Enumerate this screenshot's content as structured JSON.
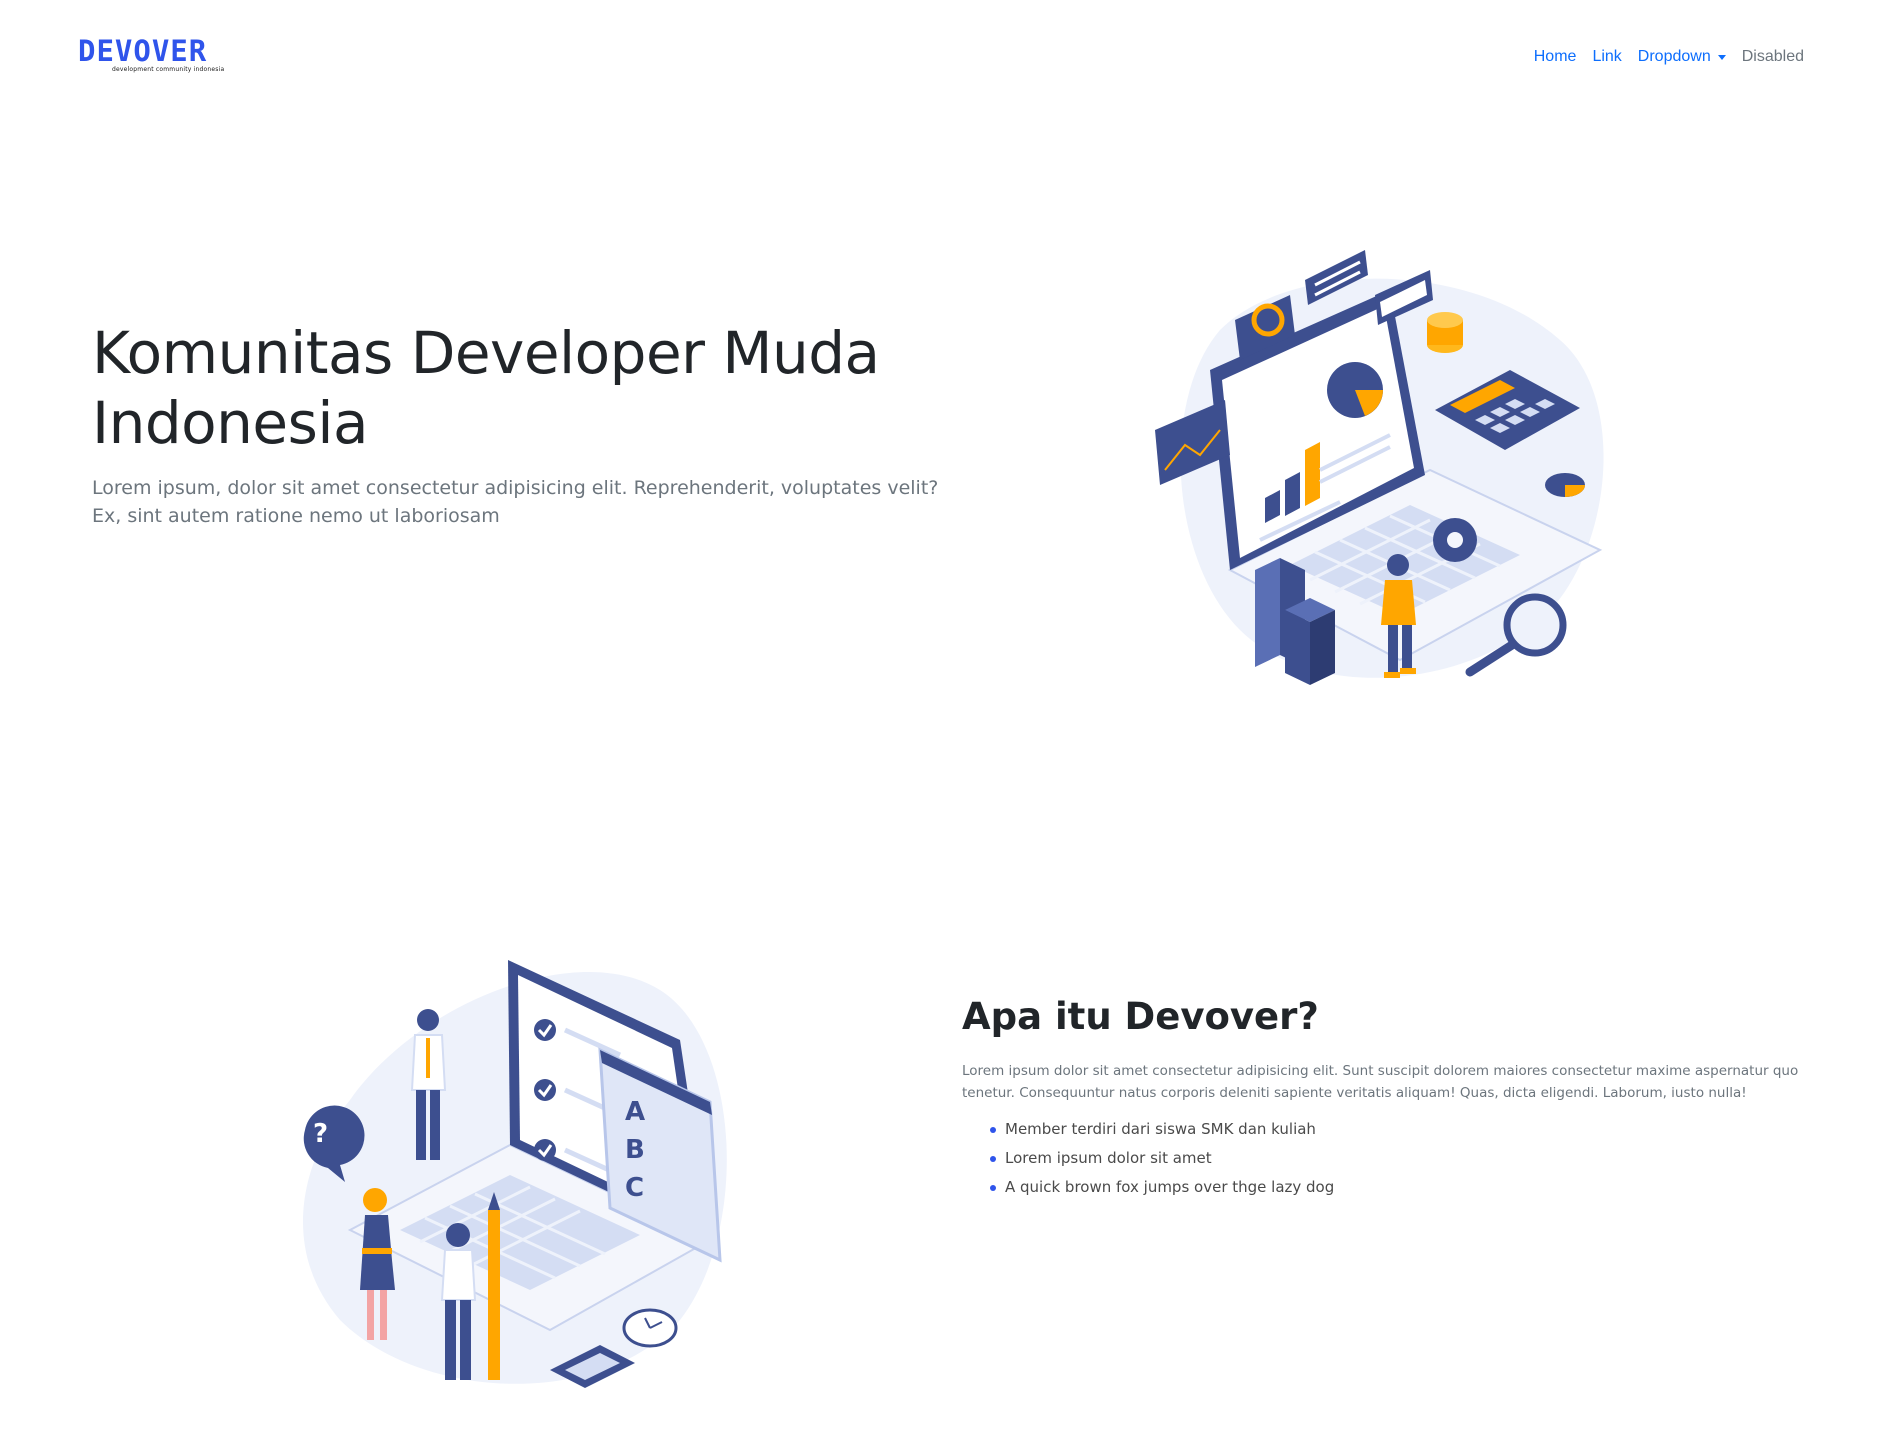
{
  "navbar": {
    "brand": {
      "name": "DEVOVER",
      "tagline": "development community indonesia",
      "color": "#2f54eb"
    },
    "links": [
      {
        "label": "Home",
        "state": "active"
      },
      {
        "label": "Link",
        "state": "normal"
      },
      {
        "label": "Dropdown",
        "state": "dropdown"
      },
      {
        "label": "Disabled",
        "state": "disabled"
      }
    ]
  },
  "hero": {
    "title": "Komunitas Developer Muda Indonesia",
    "subtitle": "Lorem ipsum, dolor sit amet consectetur adipisicing elit. Reprehenderit, voluptates velit? Ex, sint autem ratione nemo ut laboriosam",
    "illustration": "isometric-analytics-laptop-illustration"
  },
  "about": {
    "title": "Apa itu Devover?",
    "text": "Lorem ipsum dolor sit amet consectetur adipisicing elit. Sunt suscipit dolorem maiores consectetur maxime aspernatur quo tenetur. Consequuntur natus corporis deleniti sapiente veritatis aliquam! Quas, dicta eligendi. Laborum, iusto nulla!",
    "items": [
      "Member terdiri dari siswa SMK dan kuliah",
      "Lorem ipsum dolor sit amet",
      "A quick brown fox jumps over thge lazy dog"
    ],
    "illustration": "isometric-quiz-laptop-illustration",
    "quiz_letters": [
      "A",
      "B",
      "C"
    ]
  },
  "colors": {
    "primary": "#0d6efd",
    "muted": "#6c757d",
    "illus_navy": "#3d4f8f",
    "illus_orange": "#ffa600",
    "illus_blob": "#eef2fb"
  }
}
